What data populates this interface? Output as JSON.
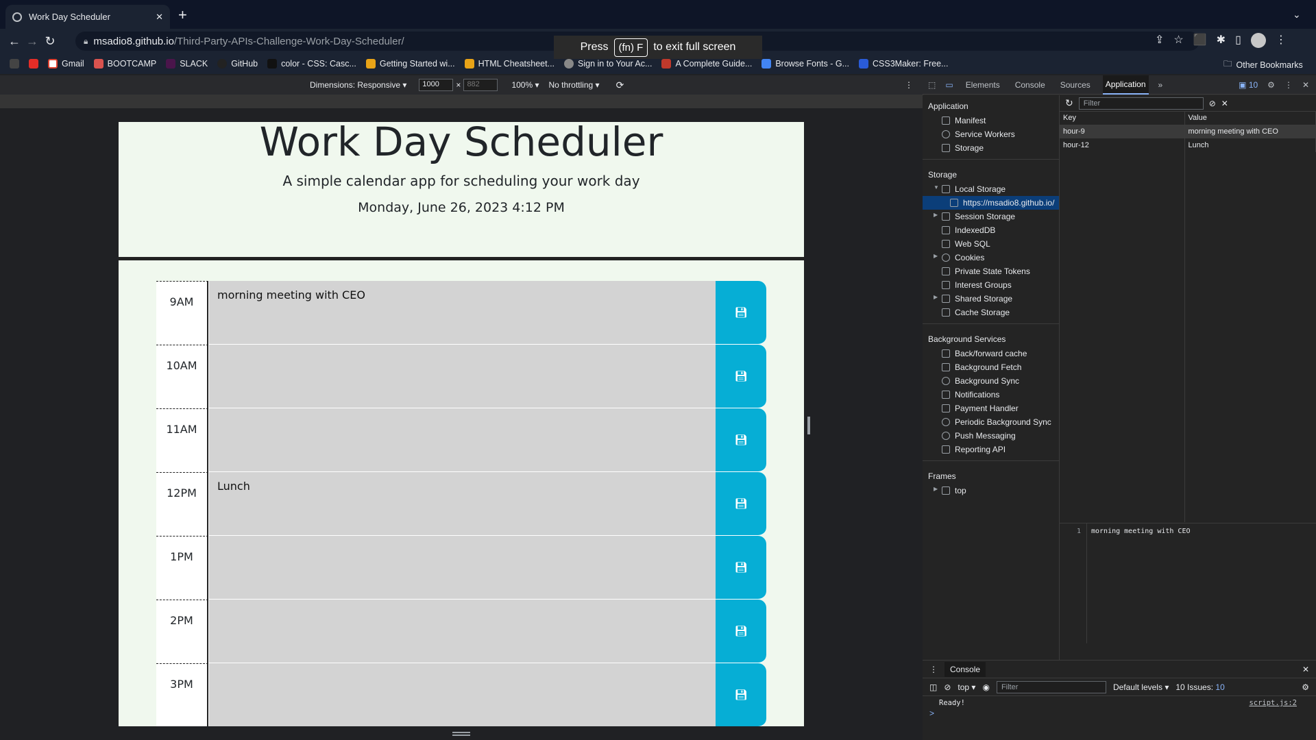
{
  "browser": {
    "tab_title": "Work Day Scheduler",
    "url_host": "msadio8.github.io",
    "url_path": "/Third-Party-APIs-Challenge-Work-Day-Scheduler/",
    "bookmarks": [
      "Gmail",
      "BOOTCAMP",
      "SLACK",
      "GitHub",
      "color - CSS: Casc...",
      "Getting Started wi...",
      "HTML Cheatsheet...",
      "Sign in to Your Ac...",
      "A Complete Guide...",
      "Browse Fonts - G...",
      "CSS3Maker: Free..."
    ],
    "other_bookmarks": "Other Bookmarks",
    "fullscreen_press": "Press",
    "fullscreen_key": "(fn) F",
    "fullscreen_msg": "to exit full screen"
  },
  "device_toolbar": {
    "dimensions": "Dimensions: Responsive",
    "width": "1000",
    "height": "882",
    "zoom": "100%",
    "throttling": "No throttling"
  },
  "page": {
    "title": "Work Day Scheduler",
    "lead": "A simple calendar app for scheduling your work day",
    "current_day": "Monday, June 26, 2023 4:12 PM",
    "rows": [
      {
        "hour": "9AM",
        "text": "morning meeting with CEO"
      },
      {
        "hour": "10AM",
        "text": ""
      },
      {
        "hour": "11AM",
        "text": ""
      },
      {
        "hour": "12PM",
        "text": "Lunch"
      },
      {
        "hour": "1PM",
        "text": ""
      },
      {
        "hour": "2PM",
        "text": ""
      },
      {
        "hour": "3PM",
        "text": ""
      }
    ]
  },
  "devtools": {
    "tabs": [
      "Elements",
      "Console",
      "Sources",
      "Application"
    ],
    "issues_badge": "10",
    "sidebar": {
      "application_header": "Application",
      "application_items": [
        "Manifest",
        "Service Workers",
        "Storage"
      ],
      "storage_header": "Storage",
      "storage_items": [
        "Local Storage",
        "https://msadio8.github.io/",
        "Session Storage",
        "IndexedDB",
        "Web SQL",
        "Cookies",
        "Private State Tokens",
        "Interest Groups",
        "Shared Storage",
        "Cache Storage"
      ],
      "background_header": "Background Services",
      "background_items": [
        "Back/forward cache",
        "Background Fetch",
        "Background Sync",
        "Notifications",
        "Payment Handler",
        "Periodic Background Sync",
        "Push Messaging",
        "Reporting API"
      ],
      "frames_header": "Frames",
      "frames_items": [
        "top"
      ]
    },
    "filter_placeholder": "Filter",
    "table": {
      "key_header": "Key",
      "value_header": "Value",
      "rows": [
        {
          "key": "hour-9",
          "value": "morning meeting with CEO"
        },
        {
          "key": "hour-12",
          "value": "Lunch"
        }
      ]
    },
    "preview_line_no": "1",
    "preview_text": "morning meeting with CEO",
    "console": {
      "tab": "Console",
      "context": "top",
      "filter_placeholder": "Filter",
      "levels": "Default levels",
      "issues": "10 Issues:",
      "issues_count": "10",
      "message": "Ready!",
      "source": "script.js:2",
      "prompt": ">"
    }
  },
  "colors": {
    "save_button": "#06aed5",
    "page_bg": "#f0f8ee",
    "row_bg": "#d3d3d3"
  }
}
